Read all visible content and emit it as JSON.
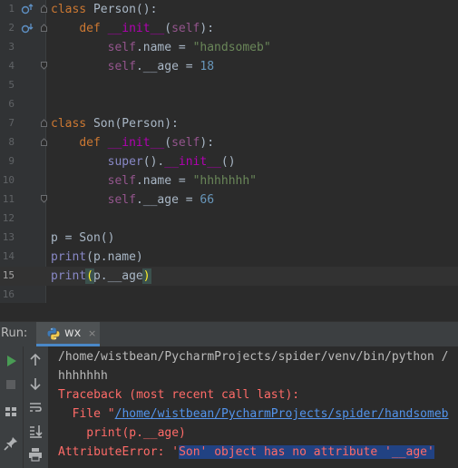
{
  "editor": {
    "lines": [
      {
        "n": "1",
        "tokens": [
          {
            "t": "class ",
            "c": "kw"
          },
          {
            "t": "Person():",
            "c": "fn"
          }
        ]
      },
      {
        "n": "2",
        "tokens": [
          {
            "t": "    "
          },
          {
            "t": "def ",
            "c": "kw"
          },
          {
            "t": "__init__",
            "c": "magic"
          },
          {
            "t": "("
          },
          {
            "t": "self",
            "c": "slf"
          },
          {
            "t": "):"
          }
        ]
      },
      {
        "n": "3",
        "tokens": [
          {
            "t": "        "
          },
          {
            "t": "self",
            "c": "slf"
          },
          {
            "t": ".name = "
          },
          {
            "t": "\"handsomeb\"",
            "c": "str"
          }
        ]
      },
      {
        "n": "4",
        "tokens": [
          {
            "t": "        "
          },
          {
            "t": "self",
            "c": "slf"
          },
          {
            "t": ".__age = "
          },
          {
            "t": "18",
            "c": "num"
          }
        ]
      },
      {
        "n": "5",
        "tokens": []
      },
      {
        "n": "6",
        "tokens": []
      },
      {
        "n": "7",
        "tokens": [
          {
            "t": "class ",
            "c": "kw"
          },
          {
            "t": "Son(Person):"
          }
        ]
      },
      {
        "n": "8",
        "tokens": [
          {
            "t": "    "
          },
          {
            "t": "def ",
            "c": "kw"
          },
          {
            "t": "__init__",
            "c": "magic"
          },
          {
            "t": "("
          },
          {
            "t": "self",
            "c": "slf"
          },
          {
            "t": "):"
          }
        ]
      },
      {
        "n": "9",
        "tokens": [
          {
            "t": "        "
          },
          {
            "t": "super",
            "c": "bi"
          },
          {
            "t": "()."
          },
          {
            "t": "__init__",
            "c": "magic"
          },
          {
            "t": "()"
          }
        ]
      },
      {
        "n": "10",
        "tokens": [
          {
            "t": "        "
          },
          {
            "t": "self",
            "c": "slf"
          },
          {
            "t": ".name = "
          },
          {
            "t": "\"hhhhhhh\"",
            "c": "str"
          }
        ]
      },
      {
        "n": "11",
        "tokens": [
          {
            "t": "        "
          },
          {
            "t": "self",
            "c": "slf"
          },
          {
            "t": ".__age = "
          },
          {
            "t": "66",
            "c": "num"
          }
        ]
      },
      {
        "n": "12",
        "tokens": []
      },
      {
        "n": "13",
        "tokens": [
          {
            "t": "p = Son()"
          }
        ]
      },
      {
        "n": "14",
        "tokens": [
          {
            "t": "print",
            "c": "bi"
          },
          {
            "t": "(p.name)"
          }
        ]
      },
      {
        "n": "15",
        "tokens": [
          {
            "t": "print",
            "c": "bi"
          },
          {
            "t": "(",
            "c": "brace-hl"
          },
          {
            "t": "p.__age"
          },
          {
            "t": ")",
            "c": "brace-hl"
          }
        ]
      },
      {
        "n": "16",
        "tokens": []
      }
    ]
  },
  "run_panel": {
    "label": "Run:",
    "tab_label": "wx",
    "tab_close": "×",
    "output": {
      "line1": "/home/wistbean/PycharmProjects/spider/venv/bin/python /",
      "line2": "hhhhhhh",
      "line3": "Traceback (most recent call last):",
      "line4_prefix": "  File \"",
      "line4_link": "/home/wistbean/PycharmProjects/spider/handsomeb",
      "line5": "    print(p.__age)",
      "line6_prefix": "AttributeError: '",
      "line6_selected": "Son' object has no attribute '__age'"
    }
  },
  "icons": {
    "gutter_override": "override-method-icon",
    "gutter_overridden": "overridden-method-icon",
    "run": "run-icon",
    "stop": "stop-icon",
    "up": "scroll-up-icon",
    "down": "scroll-down-icon",
    "layout": "layout-icon",
    "soft_wrap": "soft-wrap-icon",
    "pin": "pin-icon",
    "scroll_end": "scroll-to-end-icon",
    "print": "print-icon"
  },
  "colors": {
    "keyword": "#cc7832",
    "string": "#6a8759",
    "number": "#6897bb",
    "self": "#94558d",
    "magic": "#b200b2",
    "error": "#ff6b68",
    "link": "#5394ec",
    "selection": "#214283"
  }
}
